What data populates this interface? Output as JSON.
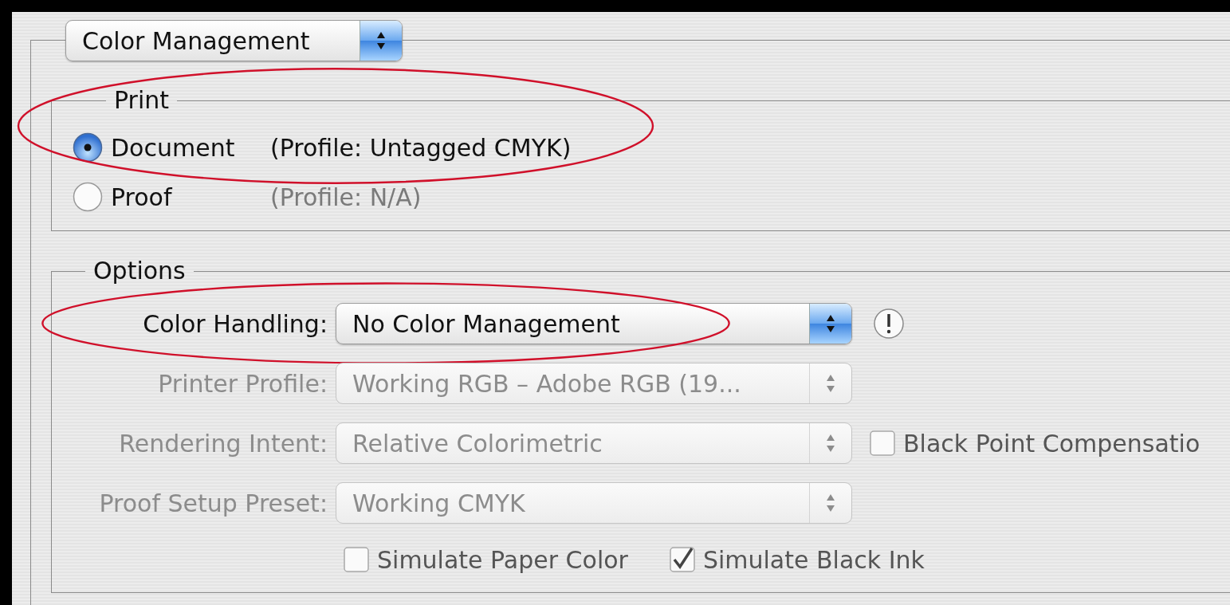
{
  "panel_popup": {
    "value": "Color Management"
  },
  "print_group": {
    "title": "Print",
    "circled": true,
    "options": [
      {
        "label": "Document",
        "profile": "(Profile: Untagged CMYK)",
        "selected": true,
        "profile_disabled": false
      },
      {
        "label": "Proof",
        "profile": "(Profile: N/A)",
        "selected": false,
        "profile_disabled": true
      }
    ]
  },
  "options_group": {
    "title": "Options",
    "rows": [
      {
        "label": "Color Handling:",
        "value": "No Color Management",
        "disabled": false,
        "circled": true,
        "kind": "alert"
      },
      {
        "label": "Printer Profile:",
        "value": "Working RGB – Adobe RGB (19...",
        "disabled": true,
        "circled": false,
        "kind": "plain"
      },
      {
        "label": "Rendering Intent:",
        "value": "Relative Colorimetric",
        "disabled": true,
        "circled": false,
        "kind": "checkbox",
        "checkbox": {
          "label": "Black Point Compensatio",
          "checked": false
        }
      },
      {
        "label": "Proof Setup Preset:",
        "value": "Working CMYK",
        "disabled": true,
        "circled": false,
        "kind": "plain"
      }
    ],
    "checkboxes": [
      {
        "label": "Simulate Paper Color",
        "checked": false
      },
      {
        "label": "Simulate Black Ink",
        "checked": true
      }
    ]
  }
}
